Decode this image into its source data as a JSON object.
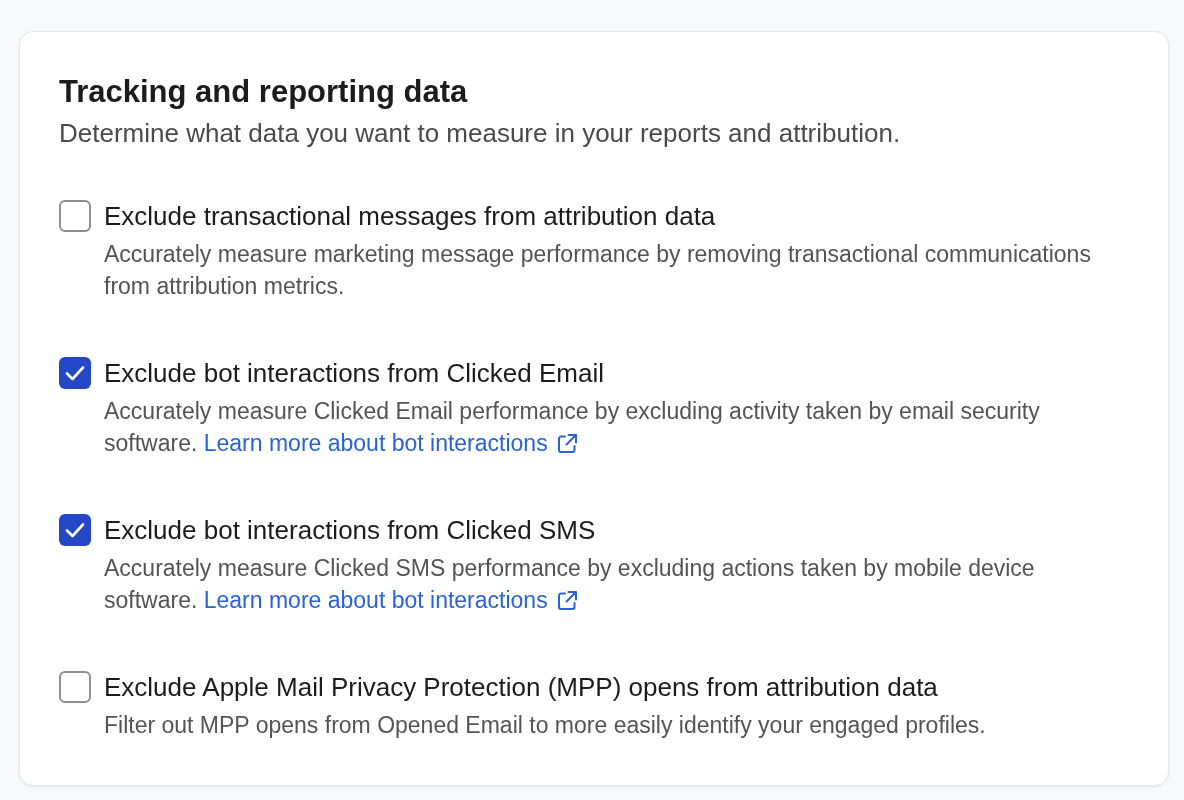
{
  "section": {
    "title": "Tracking and reporting data",
    "subtitle": "Determine what data you want to measure in your reports and attribution."
  },
  "options": [
    {
      "label": "Exclude transactional messages from attribution data",
      "description": "Accurately measure marketing message performance by removing transactional communications from attribution metrics.",
      "checked": false
    },
    {
      "label": "Exclude bot interactions from Clicked Email",
      "description": "Accurately measure Clicked Email performance by excluding activity taken by email security software.",
      "link": "Learn more about bot interactions",
      "checked": true
    },
    {
      "label": "Exclude bot interactions from Clicked SMS",
      "description": "Accurately measure Clicked SMS performance by excluding actions taken by mobile device software.",
      "link": "Learn more about bot interactions",
      "checked": true
    },
    {
      "label": "Exclude Apple Mail Privacy Protection (MPP) opens from attribution data",
      "description": "Filter out MPP opens from Opened Email to more easily identify your engaged profiles.",
      "checked": false
    }
  ]
}
